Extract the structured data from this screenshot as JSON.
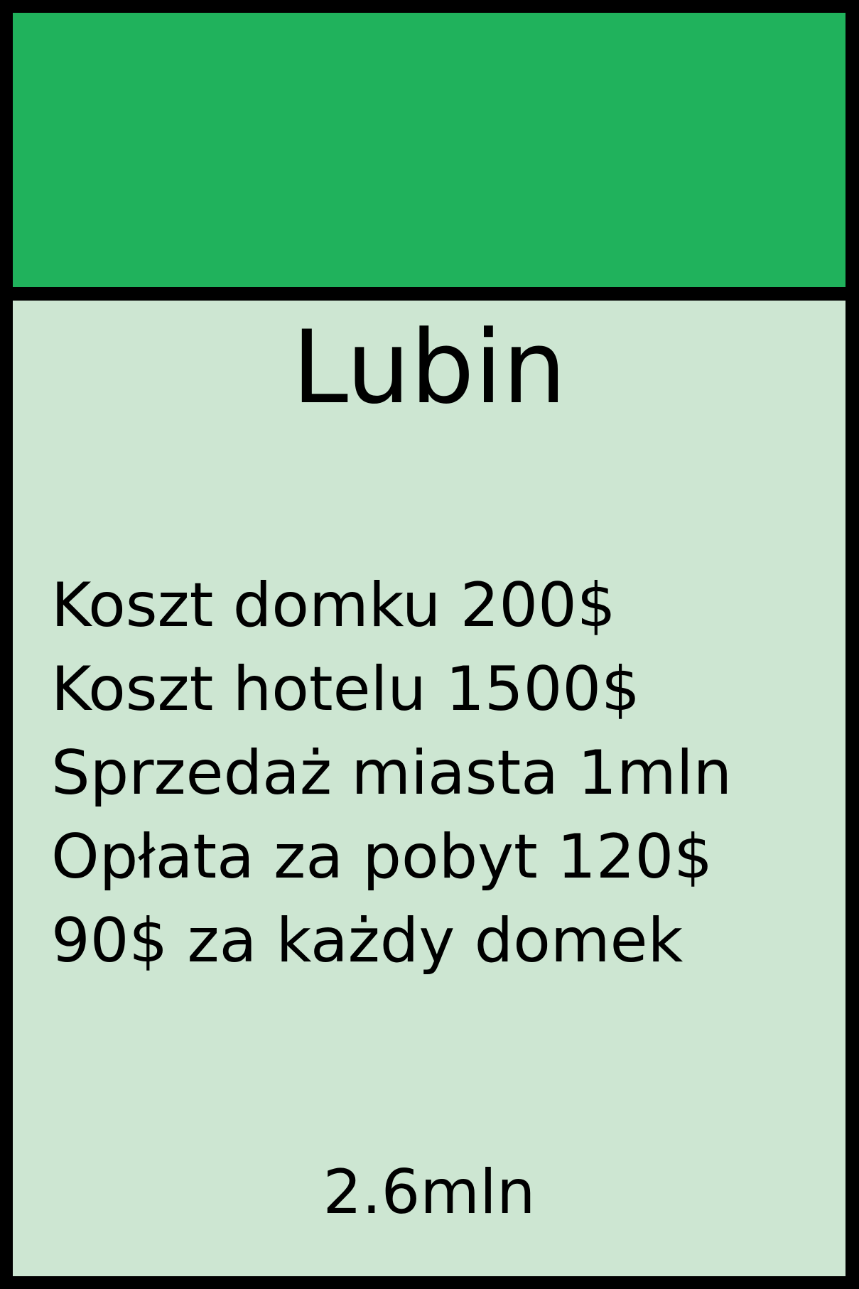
{
  "card": {
    "band_color": "#20b25c",
    "panel_color": "#cde6d2",
    "border_color": "#000000",
    "city_name": "Lubin",
    "rules": [
      "Koszt domku 200$",
      "Koszt hotelu 1500$",
      "Sprzedaż miasta 1mln",
      "Opłata za pobyt 120$",
      "90$ za każdy domek"
    ],
    "price": "2.6mln"
  }
}
